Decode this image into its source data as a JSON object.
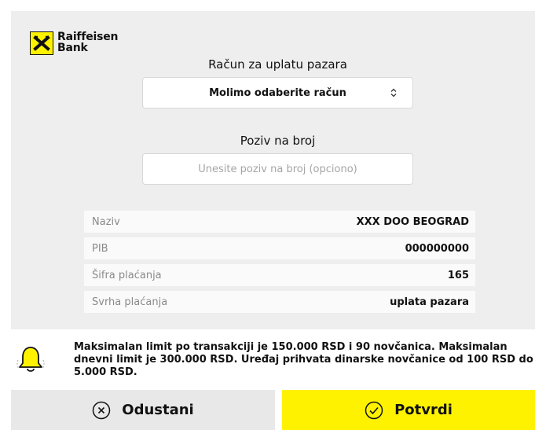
{
  "brand": {
    "name": "Raiffeisen\nBank",
    "accent_color": "#fff200"
  },
  "account_section": {
    "label": "Račun za uplatu pazara",
    "select_value": "Molimo odaberite račun",
    "select_icon": "up-down-arrows-icon"
  },
  "reference_section": {
    "label": "Poziv na broj",
    "placeholder": "Unesite poziv na broj (opciono)",
    "value": ""
  },
  "details": [
    {
      "label": "Naziv",
      "value": "XXX DOO BEOGRAD"
    },
    {
      "label": "PIB",
      "value": "000000000"
    },
    {
      "label": "Šifra plaćanja",
      "value": "165"
    },
    {
      "label": "Svrha plaćanja",
      "value": "uplata pazara"
    }
  ],
  "notice": {
    "icon": "bell-icon",
    "text": "Maksimalan limit po transakciji je 150.000 RSD i 90 novčanica. Maksimalan dnevni limit je 300.000 RSD. Uređaj prihvata dinarske novčanice od 100 RSD do 5.000 RSD."
  },
  "actions": {
    "cancel_label": "Odustani",
    "cancel_icon": "close-circle-icon",
    "confirm_label": "Potvrdi",
    "confirm_icon": "check-circle-icon"
  }
}
